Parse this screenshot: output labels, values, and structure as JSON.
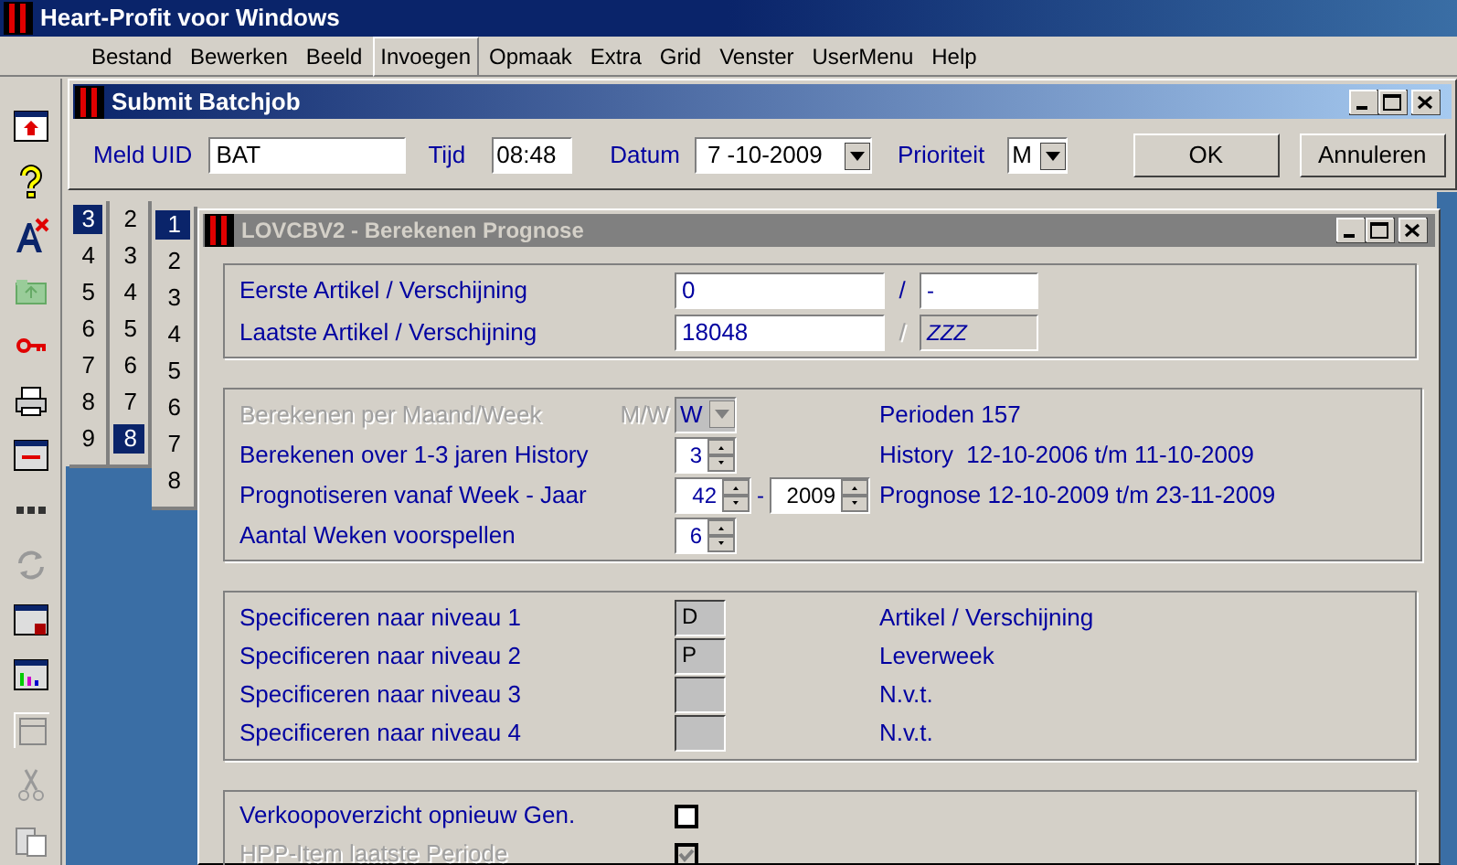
{
  "app": {
    "title": "Heart-Profit voor Windows"
  },
  "menu": [
    {
      "label": "Bestand",
      "selected": false
    },
    {
      "label": "Bewerken",
      "selected": false
    },
    {
      "label": "Beeld",
      "selected": false
    },
    {
      "label": "Invoegen",
      "selected": true
    },
    {
      "label": "Opmaak",
      "selected": false
    },
    {
      "label": "Extra",
      "selected": false
    },
    {
      "label": "Grid",
      "selected": false
    },
    {
      "label": "Venster",
      "selected": false
    },
    {
      "label": "UserMenu",
      "selected": false
    },
    {
      "label": "Help",
      "selected": false
    }
  ],
  "submit_window": {
    "title": "Submit Batchjob",
    "meld_uid": {
      "label": "Meld UID",
      "value": "BAT"
    },
    "tijd": {
      "label": "Tijd",
      "value": "08:48"
    },
    "datum": {
      "label": "Datum",
      "value": "7 -10-2009"
    },
    "prioriteit": {
      "label": "Prioriteit",
      "value": "M"
    },
    "buttons": [
      "OK",
      "Annuleren"
    ]
  },
  "popup_lists": [
    {
      "items": [
        {
          "label": "3",
          "selected": true
        },
        {
          "label": "4",
          "selected": false
        },
        {
          "label": "5",
          "selected": false
        },
        {
          "label": "6",
          "selected": false
        },
        {
          "label": "7",
          "selected": false
        },
        {
          "label": "8",
          "selected": false
        },
        {
          "label": "9",
          "selected": false
        }
      ]
    },
    {
      "items": [
        {
          "label": "2",
          "selected": false
        },
        {
          "label": "3",
          "selected": false
        },
        {
          "label": "4",
          "selected": false
        },
        {
          "label": "5",
          "selected": false
        },
        {
          "label": "6",
          "selected": false
        },
        {
          "label": "7",
          "selected": false
        },
        {
          "label": "8",
          "selected": true
        }
      ]
    },
    {
      "items": [
        {
          "label": "1",
          "selected": true
        },
        {
          "label": "2",
          "selected": false
        },
        {
          "label": "3",
          "selected": false
        },
        {
          "label": "4",
          "selected": false
        },
        {
          "label": "5",
          "selected": false
        },
        {
          "label": "6",
          "selected": false
        },
        {
          "label": "7",
          "selected": false
        },
        {
          "label": "8",
          "selected": false
        }
      ]
    }
  ],
  "prognose_window": {
    "title": "LOVCBV2 - Berekenen Prognose",
    "active": false,
    "articles": [
      {
        "label": "Eerste Artikel / Verschijning",
        "value": "0",
        "separator": "/",
        "value_2": "-",
        "disabled_2": false
      },
      {
        "label": "Laatste Artikel / Verschijning",
        "value": "18048",
        "separator": "/",
        "value_2": "ZZZ",
        "disabled_2": true
      }
    ],
    "calculation": [
      {
        "kind": "dropdown",
        "label": "Berekenen per Maand/Week",
        "hint": "M/W",
        "value": "W",
        "disabled": true,
        "info": "Perioden 157"
      },
      {
        "kind": "spinner",
        "label": "Berekenen over 1-3 jaren History",
        "value": "3",
        "disabled": false,
        "info": "History  12-10-2006 t/m 11-10-2009"
      },
      {
        "kind": "double_spinner",
        "label": "Prognotiseren vanaf Week - Jaar",
        "value": "42",
        "separator": "-",
        "value_2": "2009",
        "disabled": false,
        "info": "Prognose 12-10-2009 t/m 23-11-2009"
      },
      {
        "kind": "spinner",
        "label": "Aantal Weken voorspellen",
        "value": "6",
        "disabled": false
      }
    ],
    "levels": [
      {
        "label": "Specificeren naar niveau 1",
        "value": "D",
        "description": "Artikel / Verschijning"
      },
      {
        "label": "Specificeren naar niveau 2",
        "value": "P",
        "description": "Leverweek"
      },
      {
        "label": "Specificeren naar niveau 3",
        "description": "N.v.t."
      },
      {
        "label": "Specificeren naar niveau 4",
        "description": "N.v.t."
      }
    ],
    "options": [
      {
        "label": "Verkoopoverzicht opnieuw Gen.",
        "checked": false,
        "disabled": false
      },
      {
        "label": "HPP-Item laatste Periode",
        "checked": true,
        "disabled": true
      }
    ]
  }
}
